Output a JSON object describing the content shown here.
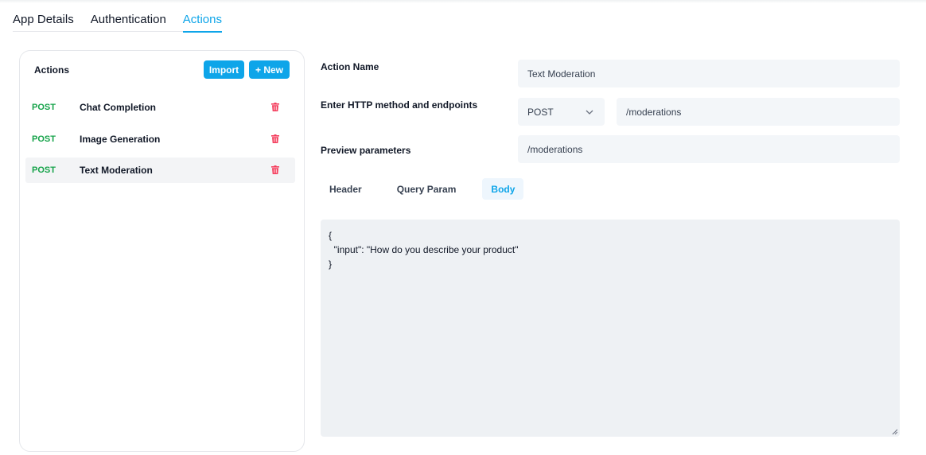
{
  "top_tabs": [
    {
      "label": "App Details"
    },
    {
      "label": "Authentication"
    },
    {
      "label": "Actions"
    }
  ],
  "actions_panel": {
    "title": "Actions",
    "import_label": "Import",
    "new_label": "+ New",
    "items": [
      {
        "method": "POST",
        "name": "Chat Completion",
        "selected": false
      },
      {
        "method": "POST",
        "name": "Image Generation",
        "selected": false
      },
      {
        "method": "POST",
        "name": "Text Moderation",
        "selected": true
      }
    ]
  },
  "form": {
    "action_name_label": "Action Name",
    "action_name_value": "Text Moderation",
    "http_label": "Enter HTTP method and endpoints",
    "http_method": "POST",
    "endpoint_value": "/moderations",
    "preview_label": "Preview parameters",
    "preview_value": "/moderations"
  },
  "sub_tabs": [
    {
      "label": "Header"
    },
    {
      "label": "Query Param"
    },
    {
      "label": "Body"
    }
  ],
  "body_text": "{\n  \"input\": \"How do you describe your product\"\n}",
  "colors": {
    "accent": "#0ea5e9",
    "method_post": "#16a34a",
    "delete": "#f43f5e",
    "field_bg": "#f3f6f9"
  },
  "icons": {
    "delete": "trash-icon",
    "dropdown": "chevron-down-icon",
    "resize": "resize-grip-icon"
  }
}
